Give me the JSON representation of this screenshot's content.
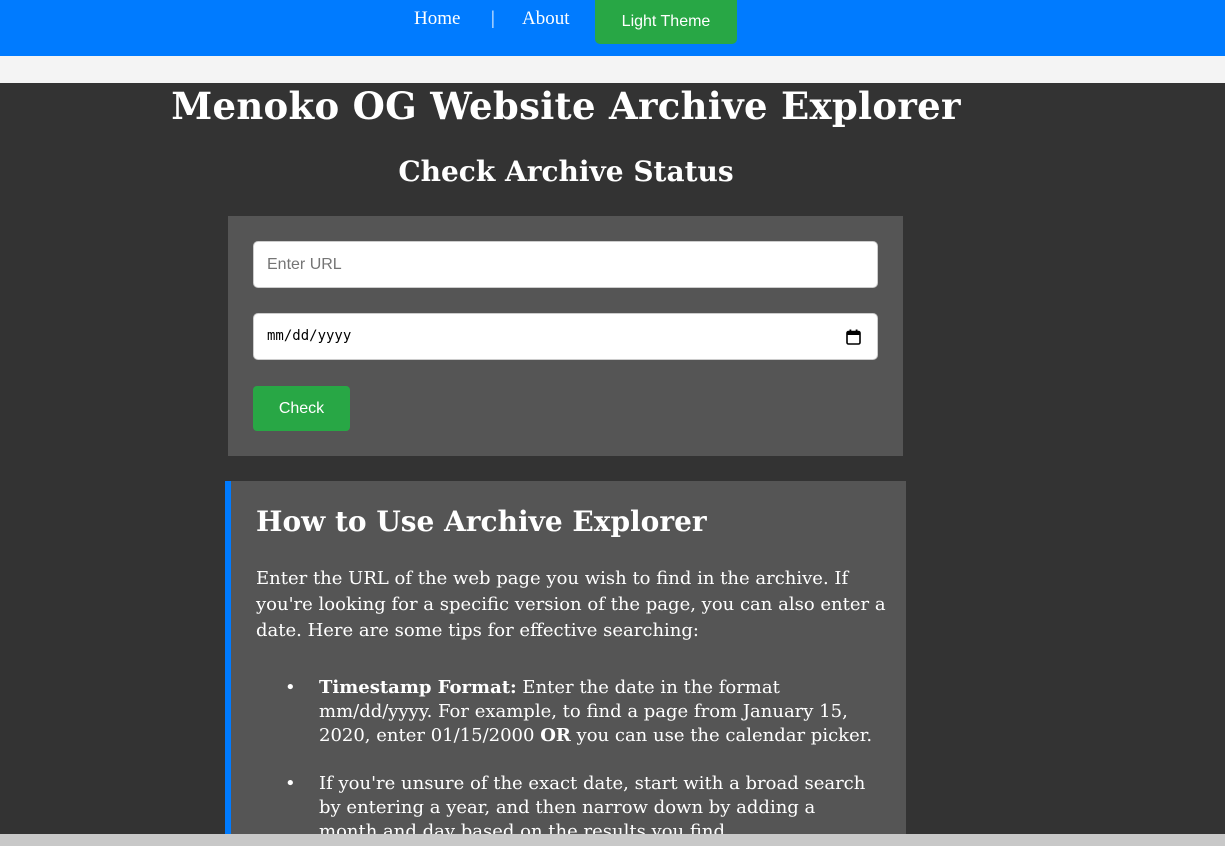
{
  "nav": {
    "home": "Home",
    "separator": "|",
    "about": "About",
    "theme_button": "Light Theme"
  },
  "page": {
    "title": "Menoko OG Website Archive Explorer",
    "section_title": "Check Archive Status"
  },
  "form": {
    "url_placeholder": "Enter URL",
    "url_value": "",
    "date_placeholder": "mm/dd/yyyy",
    "check_button": "Check"
  },
  "info": {
    "title": "How to Use Archive Explorer",
    "paragraph": "Enter the URL of the web page you wish to find in the archive. If you're looking for a specific version of the page, you can also enter a date. Here are some tips for effective searching:",
    "tips": [
      {
        "label": "Timestamp Format:",
        "text_a": " Enter the date in the format mm/dd/yyyy. For example, to find a page from January 15, 2020, enter 01/15/2000 ",
        "emphasis": "OR",
        "text_b": " you can use the calendar picker."
      },
      {
        "text": "If you're unsure of the exact date, start with a broad search by entering a year, and then narrow down by adding a month and day based on the results you find."
      }
    ]
  },
  "colors": {
    "nav_bg": "#007bff",
    "accent_green": "#28a745",
    "page_bg": "#333333",
    "panel_bg": "#555555",
    "info_border": "#007bff"
  },
  "icons": {
    "date_picker": "calendar-icon"
  }
}
